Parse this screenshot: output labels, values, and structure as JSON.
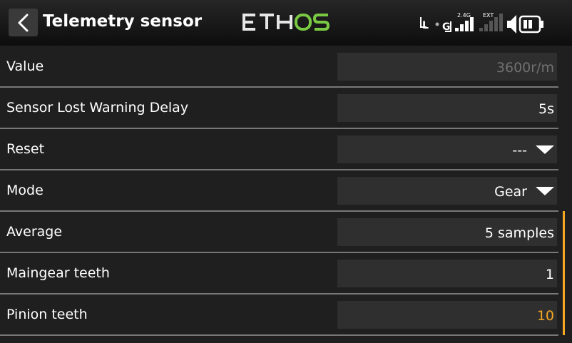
{
  "header": {
    "back_label": "Back",
    "title": "Telemetry sensor",
    "logo": "ETHOS",
    "status": {
      "indicator_l": "L",
      "indicator_g": "G",
      "band_24g": "2.4G",
      "band_ext": "EXT"
    }
  },
  "rows": [
    {
      "label": "Value",
      "value": "3600r/m",
      "style": "dim",
      "dropdown": false
    },
    {
      "label": "Sensor Lost Warning Delay",
      "value": "5s",
      "style": "normal",
      "dropdown": false
    },
    {
      "label": "Reset",
      "value": "---",
      "style": "normal",
      "dropdown": true
    },
    {
      "label": "Mode",
      "value": "Gear",
      "style": "normal",
      "dropdown": true
    },
    {
      "label": "Average",
      "value": "5 samples",
      "style": "normal",
      "dropdown": false
    },
    {
      "label": "Maingear teeth",
      "value": "1",
      "style": "normal",
      "dropdown": false
    },
    {
      "label": "Pinion teeth",
      "value": "10",
      "style": "accent",
      "dropdown": false
    }
  ],
  "colors": {
    "accent": "#f5a623",
    "logo_green": "#7ac943",
    "background": "#1f1f1f",
    "field": "#2f2f2f"
  }
}
